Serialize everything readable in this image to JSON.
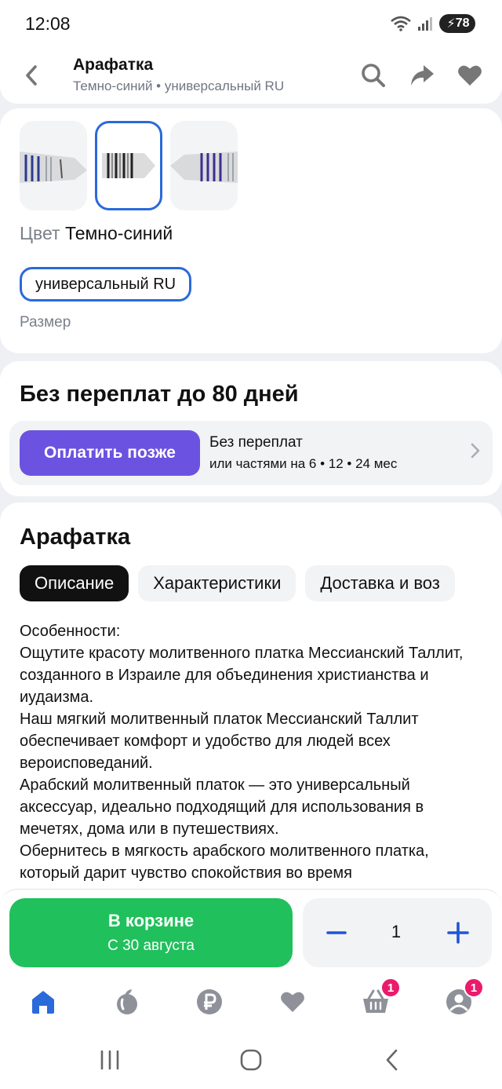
{
  "status_bar": {
    "time": "12:08",
    "battery": "78"
  },
  "header": {
    "title": "Арафатка",
    "subtitle": "Темно-синий • универсальный RU"
  },
  "variants": {
    "color_label": "Цвет",
    "color_value": "Темно-синий",
    "size_option": "универсальный RU",
    "size_label": "Размер"
  },
  "bnpl": {
    "heading": "Без переплат до 80 дней",
    "pay_later_label": "Оплатить позже",
    "line1": "Без переплат",
    "line2": "или частями на 6 • 12 • 24 мес"
  },
  "product": {
    "title": "Арафатка",
    "tabs": [
      {
        "label": "Описание"
      },
      {
        "label": "Характеристики"
      },
      {
        "label": "Доставка и воз"
      }
    ],
    "description": [
      "Особенности:",
      "Ощутите красоту молитвенного платка Мессианский Таллит, созданного в Израиле для объединения христианства и иудаизма.",
      "Наш мягкий молитвенный платок Мессианский Таллит обеспечивает комфорт и удобство для людей всех вероисповеданий.",
      "Арабский молитвенный платок — это универсальный аксессуар, идеально подходящий для использования в мечетях, дома или в путешествиях.",
      "Обернитесь в мягкость арабского молитвенного платка, который дарит чувство спокойствия во время"
    ]
  },
  "action": {
    "cart_label": "В корзине",
    "cart_sub": "С 30 августа",
    "quantity": "1"
  },
  "bottom_nav": {
    "cart_badge": "1",
    "profile_badge": "1"
  },
  "colors": {
    "accent_blue": "#2a6ad9",
    "pay_later_purple": "#6c52e0",
    "cart_green": "#20c05c",
    "badge_pink": "#ea1b6b"
  }
}
